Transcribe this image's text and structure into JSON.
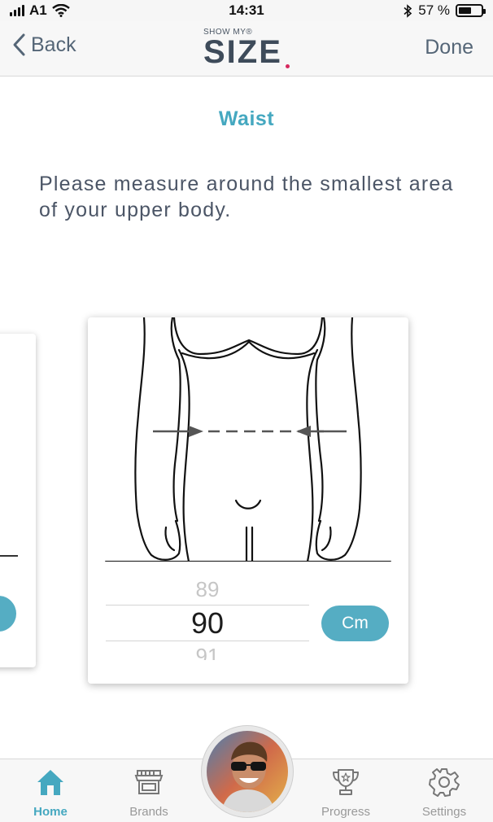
{
  "status_bar": {
    "carrier": "A1",
    "time": "14:31",
    "battery": "57 %",
    "battery_level": 0.57
  },
  "nav": {
    "back_label": "Back",
    "done_label": "Done",
    "logo_top": "SHOW MY®",
    "logo_main": "SIZE",
    "accent_color": "#d6285e"
  },
  "screen": {
    "title": "Waist",
    "instruction": "Please measure around the smallest area of your upper body.",
    "title_color": "#45a8c0"
  },
  "measurement": {
    "previous_value": "89",
    "current_value": "90",
    "next_value": "91",
    "unit_label": "Cm",
    "button_color": "#55adc3"
  },
  "tab_bar": {
    "items": [
      {
        "label": "Home",
        "icon": "home-icon",
        "active": true
      },
      {
        "label": "Brands",
        "icon": "store-icon",
        "active": false
      },
      {
        "label": "Progress",
        "icon": "trophy-icon",
        "active": false
      },
      {
        "label": "Settings",
        "icon": "gear-icon",
        "active": false
      }
    ],
    "center_avatar": "profile-avatar"
  }
}
